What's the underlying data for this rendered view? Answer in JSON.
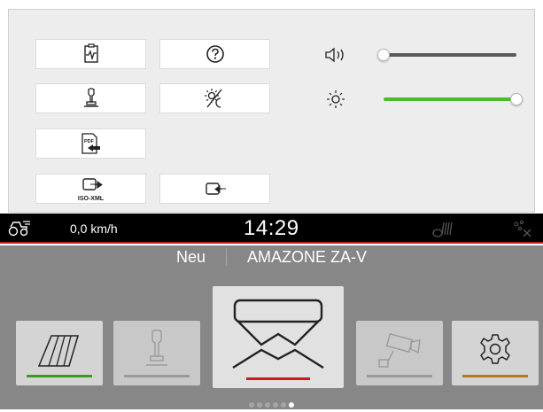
{
  "panel": {
    "tiles": [
      {
        "name": "diagnostics-button",
        "icon": "diagnostics-icon"
      },
      {
        "name": "help-button",
        "icon": "question-icon"
      },
      {
        "name": "joystick-button",
        "icon": "joystick-icon"
      },
      {
        "name": "day-night-button",
        "icon": "day-night-icon"
      },
      {
        "name": "pdf-export-button",
        "icon": "pdf-export-icon"
      },
      {
        "name": "isoxml-export-button",
        "icon": "export-icon",
        "label": "ISO-XML"
      },
      {
        "name": "import-button",
        "icon": "import-icon"
      }
    ],
    "volume": {
      "icon": "speaker-icon",
      "level": 0.0,
      "color": "#5a5a5a"
    },
    "brightness": {
      "icon": "sun-icon",
      "level": 1.0,
      "color": "#4cbb2c"
    }
  },
  "status": {
    "speed": "0,0 km/h",
    "time": "14:29",
    "left_icon": "tractor-speed-icon",
    "gps_icon": "gps-signal-icon",
    "sat_icon": "satellite-off-icon",
    "accent": "#c51d1d"
  },
  "machine": {
    "status_word": "Neu",
    "name": "AMAZONE ZA-V"
  },
  "menu": [
    {
      "name": "menu-field",
      "icon": "field-icon",
      "bar_color": "#3a9a28",
      "enabled": true
    },
    {
      "name": "menu-joystick",
      "icon": "joystick-icon",
      "bar_color": "#9a9a9a",
      "enabled": false
    },
    {
      "name": "menu-spreader",
      "icon": "spreader-icon",
      "bar_color": "#c51d1d",
      "enabled": true,
      "selected": true
    },
    {
      "name": "menu-camera",
      "icon": "camera-icon",
      "bar_color": "#9a9a9a",
      "enabled": false
    },
    {
      "name": "menu-settings",
      "icon": "gear-icon",
      "bar_color": "#b07a1e",
      "enabled": true
    }
  ],
  "pager": {
    "count": 6,
    "active": 5
  }
}
